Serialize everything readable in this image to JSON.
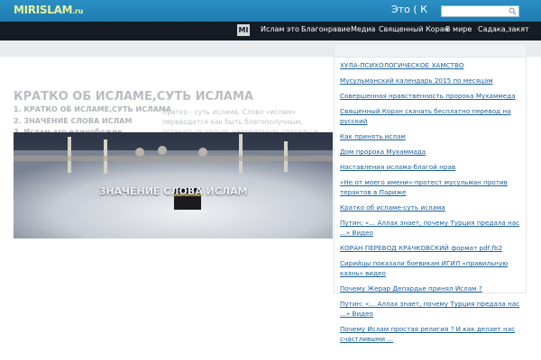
{
  "header": {
    "logo_text": "MIRISLAM",
    "logo_domain": ".ru",
    "marquee_text": "Это ( К",
    "search": {
      "placeholder": ""
    }
  },
  "nav": {
    "logo_text": "MI",
    "items": [
      "Ислам это",
      "Благонравие",
      "Медиа",
      "Священный Коран",
      "В мире",
      "Садака,закят"
    ]
  },
  "main": {
    "title": "КРАТКО ОБ ИСЛАМЕ,СУТЬ ИСЛАМА",
    "toc": [
      "1. КРАТКО ОБ ИСЛАМЕ,СУТЬ ИСЛАМА",
      "2. ЗНАЧЕНИЕ СЛОВА ИСЛАМ",
      "3. Ислам-это единобожие"
    ],
    "intro": "Кратко - суть ислама.  Слово «ислам» переводится как быть благополучным, оставаться целым, невредимым, спасаться,",
    "hero_caption": "ЗНАЧЕНИЕ СЛОВА ИСЛАМ"
  },
  "sidebar": {
    "links": [
      "ХУЛА-ПСИХОЛОГИЧЕСКОЕ ХАМСТВО",
      "Мусульманский календарь 2015 по месяцам",
      "Совершенная нравственность пророка Мухаммеда",
      "Священный Коран скачать бесплатно перевод на русский",
      "Как принять ислам",
      "Дом пророка Мухаммада",
      "Наставления ислама-благой нрав",
      "«Не от моего имени»-протест мусульман против терактов в Париже",
      "Кратко об исламе-суть ислама",
      "Путин: «... Аллах знает, почему Турция предала нас ...» Видео",
      "КОРАН ПЕРЕВОД КРАЧКОВСКИЙ формат pdf,fb2",
      "Сирийцы показали боевикам ИГИЛ «правильную казнь» видео",
      "Почему Жерар Депардье принял Ислам ?",
      "Путин: «... Аллах знает, почему Турция предала нас ...» Видео",
      "Почему Ислам простая религия ? И как делает нас счастливыми ..."
    ]
  }
}
